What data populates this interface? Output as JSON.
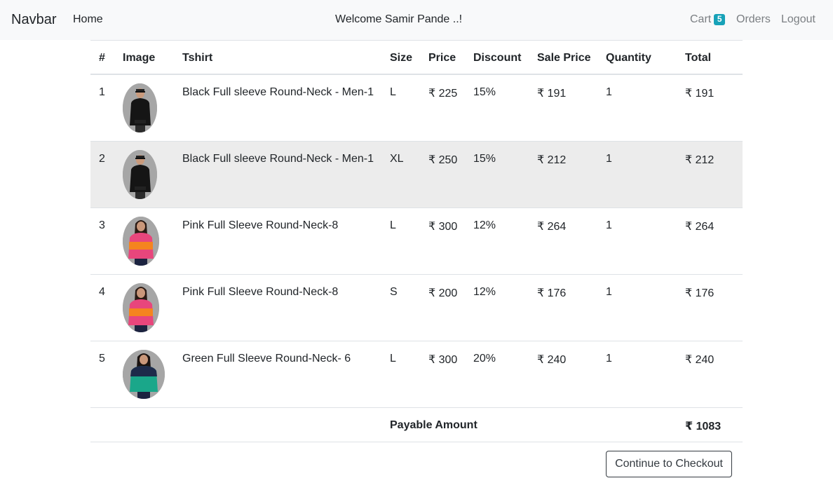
{
  "navbar": {
    "brand": "Navbar",
    "home": "Home",
    "welcome": "Welcome Samir Pande ..!",
    "cart_label": "Cart",
    "cart_count": "5",
    "orders": "Orders",
    "logout": "Logout"
  },
  "table": {
    "headers": [
      "#",
      "Image",
      "Tshirt",
      "Size",
      "Price",
      "Discount",
      "Sale Price",
      "Quantity",
      "Total"
    ],
    "rows": [
      {
        "num": "1",
        "image": "black-tshirt-man",
        "name": "Black Full sleeve Round-Neck - Men-1",
        "size": "L",
        "price": "₹ 225",
        "discount": "15%",
        "sale_price": "₹ 191",
        "quantity": "1",
        "total": "₹ 191"
      },
      {
        "num": "2",
        "image": "black-tshirt-man",
        "name": "Black Full sleeve Round-Neck - Men-1",
        "size": "XL",
        "price": "₹ 250",
        "discount": "15%",
        "sale_price": "₹ 212",
        "quantity": "1",
        "total": "₹ 212"
      },
      {
        "num": "3",
        "image": "pink-orange-tshirt-woman",
        "name": "Pink Full Sleeve Round-Neck-8",
        "size": "L",
        "price": "₹ 300",
        "discount": "12%",
        "sale_price": "₹ 264",
        "quantity": "1",
        "total": "₹ 264"
      },
      {
        "num": "4",
        "image": "pink-orange-tshirt-woman",
        "name": "Pink Full Sleeve Round-Neck-8",
        "size": "S",
        "price": "₹ 200",
        "discount": "12%",
        "sale_price": "₹ 176",
        "quantity": "1",
        "total": "₹ 176"
      },
      {
        "num": "5",
        "image": "green-navy-tshirt-woman",
        "name": "Green Full Sleeve Round-Neck- 6",
        "size": "L",
        "price": "₹ 300",
        "discount": "20%",
        "sale_price": "₹ 240",
        "quantity": "1",
        "total": "₹ 240"
      }
    ],
    "footer": {
      "label": "Payable Amount",
      "total": "₹ 1083"
    }
  },
  "checkout_button": "Continue to Checkout",
  "colors": {
    "navbar_bg": "#f8f9fa",
    "badge": "#17a2b8",
    "highlight_row": "#ececec",
    "muted_link": "#7b7f83"
  }
}
